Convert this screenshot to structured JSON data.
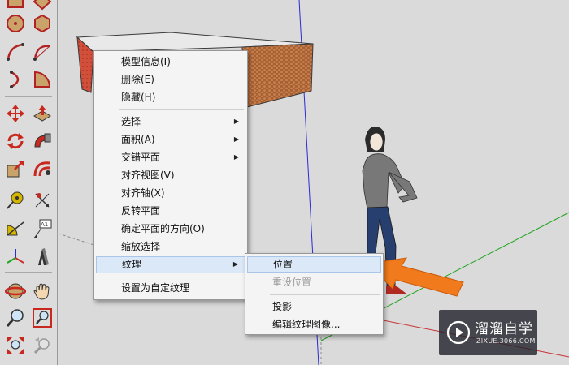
{
  "toolbar": {
    "tools": [
      "rectangle-icon",
      "rotated-rectangle-icon",
      "circle-icon",
      "polygon-icon",
      "arc-icon",
      "two-point-arc-icon",
      "three-point-arc-icon",
      "pie-icon",
      "move-icon",
      "push-pull-icon",
      "rotate-icon",
      "follow-me-icon",
      "scale-icon",
      "offset-icon",
      "tape-measure-icon",
      "dimension-icon",
      "protractor-icon",
      "text-icon",
      "axes-icon",
      "3d-text-icon",
      "orbit-icon",
      "pan-icon",
      "zoom-icon",
      "zoom-window-icon",
      "zoom-extents-icon",
      "previous-view-icon"
    ]
  },
  "context_menu": {
    "items": [
      {
        "label": "模型信息(I)",
        "submenu": false
      },
      {
        "label": "删除(E)",
        "submenu": false
      },
      {
        "label": "隐藏(H)",
        "submenu": false
      },
      {
        "label": "选择",
        "submenu": true
      },
      {
        "label": "面积(A)",
        "submenu": true
      },
      {
        "label": "交错平面",
        "submenu": true
      },
      {
        "label": "对齐视图(V)",
        "submenu": false
      },
      {
        "label": "对齐轴(X)",
        "submenu": false
      },
      {
        "label": "反转平面",
        "submenu": false
      },
      {
        "label": "确定平面的方向(O)",
        "submenu": false
      },
      {
        "label": "缩放选择",
        "submenu": false
      },
      {
        "label": "纹理",
        "submenu": true,
        "highlighted": true
      },
      {
        "label": "设置为自定纹理",
        "submenu": false
      }
    ],
    "submenu_arrow": "▶"
  },
  "texture_submenu": {
    "items": [
      {
        "label": "位置",
        "highlighted": true
      },
      {
        "label": "重设位置",
        "disabled": true
      },
      {
        "label": "投影"
      },
      {
        "label": "编辑纹理图像..."
      }
    ]
  },
  "annotation": {
    "arrow_color": "#f07a1c"
  },
  "watermark": {
    "name": "溜溜自学",
    "url": "ZIXUE.3066.COM"
  },
  "colors": {
    "highlight_bg": "#dbe8f7",
    "box_texture": "#b86a3b",
    "box_left_face": "#d24a3a",
    "axis_blue": "#2b2bd6",
    "axis_green": "#1fa51f",
    "axis_red": "#c83232"
  }
}
